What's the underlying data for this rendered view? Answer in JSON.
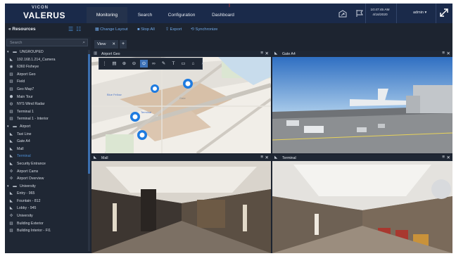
{
  "app": {
    "brand_top": "VICON",
    "brand_main": "VALERUS"
  },
  "nav": {
    "tabs": [
      {
        "label": "Monitoring",
        "active": true
      },
      {
        "label": "Search"
      },
      {
        "label": "Configuration"
      },
      {
        "label": "Dashboard",
        "alert": "!"
      }
    ]
  },
  "header": {
    "time": "10:47:45 AM",
    "date": "4/16/2020",
    "user": "admin ▾",
    "icons": [
      "map-share-icon",
      "flag-icon",
      "expand-icon"
    ]
  },
  "toolbar": {
    "resources_label": "Resources",
    "change_layout": "Change Layout",
    "stop_all": "Stop All",
    "export": "Export",
    "synchronize": "Synchronize"
  },
  "sidebar": {
    "search_placeholder": "Search",
    "items": [
      {
        "label": "UNGROUPED",
        "type": "group",
        "level": 0
      },
      {
        "label": "192.168.1.214_Camera",
        "type": "camera",
        "level": 1
      },
      {
        "label": "6360 Fisheye",
        "type": "fisheye",
        "level": 1
      },
      {
        "label": "Airport Geo",
        "type": "map",
        "level": 1
      },
      {
        "label": "Field",
        "type": "map",
        "level": 1
      },
      {
        "label": "Geo Map7",
        "type": "map",
        "level": 1
      },
      {
        "label": "Main Tour",
        "type": "tour",
        "level": 1
      },
      {
        "label": "NYS Wind Radar",
        "type": "web",
        "level": 1
      },
      {
        "label": "Terminal 1",
        "type": "map",
        "level": 1
      },
      {
        "label": "Terminal 1 - Interior",
        "type": "map",
        "level": 1
      },
      {
        "label": "Airport",
        "type": "group",
        "level": 0
      },
      {
        "label": "Taxi Line",
        "type": "camera",
        "level": 1
      },
      {
        "label": "Gate A4",
        "type": "camera",
        "level": 1
      },
      {
        "label": "Mall",
        "type": "camera",
        "level": 1
      },
      {
        "label": "Terminal",
        "type": "camera",
        "level": 1,
        "selected": true
      },
      {
        "label": "Security Entrance",
        "type": "camera",
        "level": 1
      },
      {
        "label": "Airport Cams",
        "type": "salvo",
        "level": 1
      },
      {
        "label": "Airport Overview",
        "type": "salvo",
        "level": 1
      },
      {
        "label": "University",
        "type": "group",
        "level": 0
      },
      {
        "label": "Entry - 965",
        "type": "camera",
        "level": 1
      },
      {
        "label": "Fountain - 812",
        "type": "camera",
        "level": 1
      },
      {
        "label": "Lobby - 945",
        "type": "camera",
        "level": 1
      },
      {
        "label": "University",
        "type": "salvo",
        "level": 1
      },
      {
        "label": "Building Exterior",
        "type": "map",
        "level": 1
      },
      {
        "label": "Building Interior - FI1",
        "type": "map",
        "level": 1
      }
    ]
  },
  "view": {
    "tab_label": "View",
    "add_label": "+",
    "panes": [
      {
        "title": "Airport Geo",
        "kind": "map"
      },
      {
        "title": "Gate A4",
        "kind": "camera"
      },
      {
        "title": "Mall",
        "kind": "camera"
      },
      {
        "title": "Terminal",
        "kind": "camera"
      }
    ],
    "map_labels": [
      "Blue Fellow",
      "Terminal",
      "Gate"
    ]
  },
  "colors": {
    "topbar": "#1a2a4a",
    "accent": "#3d72b8",
    "link": "#6fa8e8",
    "alert": "#e0443a"
  }
}
